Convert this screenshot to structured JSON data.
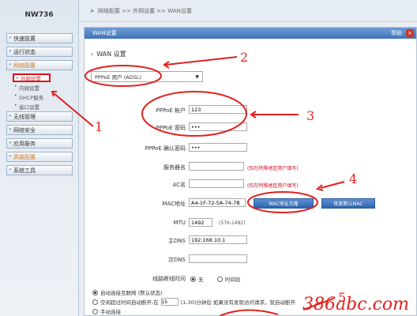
{
  "sidebar": {
    "logo": "NW736",
    "items": [
      {
        "label": "快速設置"
      },
      {
        "label": "运行状态"
      },
      {
        "label": "网络配置"
      }
    ],
    "subitems": [
      {
        "label": "外网设置"
      },
      {
        "label": "内网设置"
      },
      {
        "label": "DHCP服务"
      },
      {
        "label": "接口设置"
      }
    ],
    "items2": [
      {
        "label": "无线管理"
      },
      {
        "label": "网络安全"
      },
      {
        "label": "应用服务"
      },
      {
        "label": "高级配置"
      },
      {
        "label": "系统工具"
      }
    ]
  },
  "breadcrumb": {
    "home": "网络配置",
    "sep1": ">>",
    "mid": "外网设置",
    "sep2": ">>",
    "current": "WAN设置"
  },
  "panel": {
    "tab": "WAN设置",
    "help": "帮助",
    "close": "×",
    "section_title": "WAN 设置",
    "mode_selected": "PPPoE 用户 (ADSL)"
  },
  "form": {
    "account_label": "PPPoE 帐户",
    "account_value": "123",
    "password_label": "PPPoE 密码",
    "password_value": "•••",
    "confirm_label": "PPPoE 确认密码",
    "confirm_value": "•••",
    "service_label": "服务器名",
    "service_hint": "(仅在特殊地区用户填写)",
    "ac_label": "AC名",
    "ac_hint": "(仅在特殊地区用户填写)",
    "mac_label": "MAC地址",
    "mac_value": "A4-1F-72-5A-74-7B",
    "mac_clone_btn": "MAC地址克隆",
    "mac_restore_btn": "恢复默认MAC",
    "mtu_label": "MTU",
    "mtu_value": "1492",
    "mtu_hint": "(576-1492)",
    "dns1_label": "主DNS",
    "dns1_value": "192.168.10.1",
    "dns2_label": "次DNS",
    "dns2_value": "",
    "timer_label": "线路断线时间",
    "timer_opt1": "无",
    "timer_opt2": "时间段"
  },
  "connect": {
    "opt1": "自动连接互联网 (默认状态)",
    "opt2_prefix": "空闲超过时间自动断开,在",
    "opt2_value": "15",
    "opt2_suffix": "(1-30)分钟后 如果没有发现访问请求，就自动断开",
    "opt3": "手动连接"
  },
  "annotations": [
    "1",
    "2",
    "3",
    "4",
    "5"
  ],
  "watermark": "386abc.com",
  "colors": {
    "accent": "#3f74bb",
    "annotation_red": "#e0211d"
  }
}
